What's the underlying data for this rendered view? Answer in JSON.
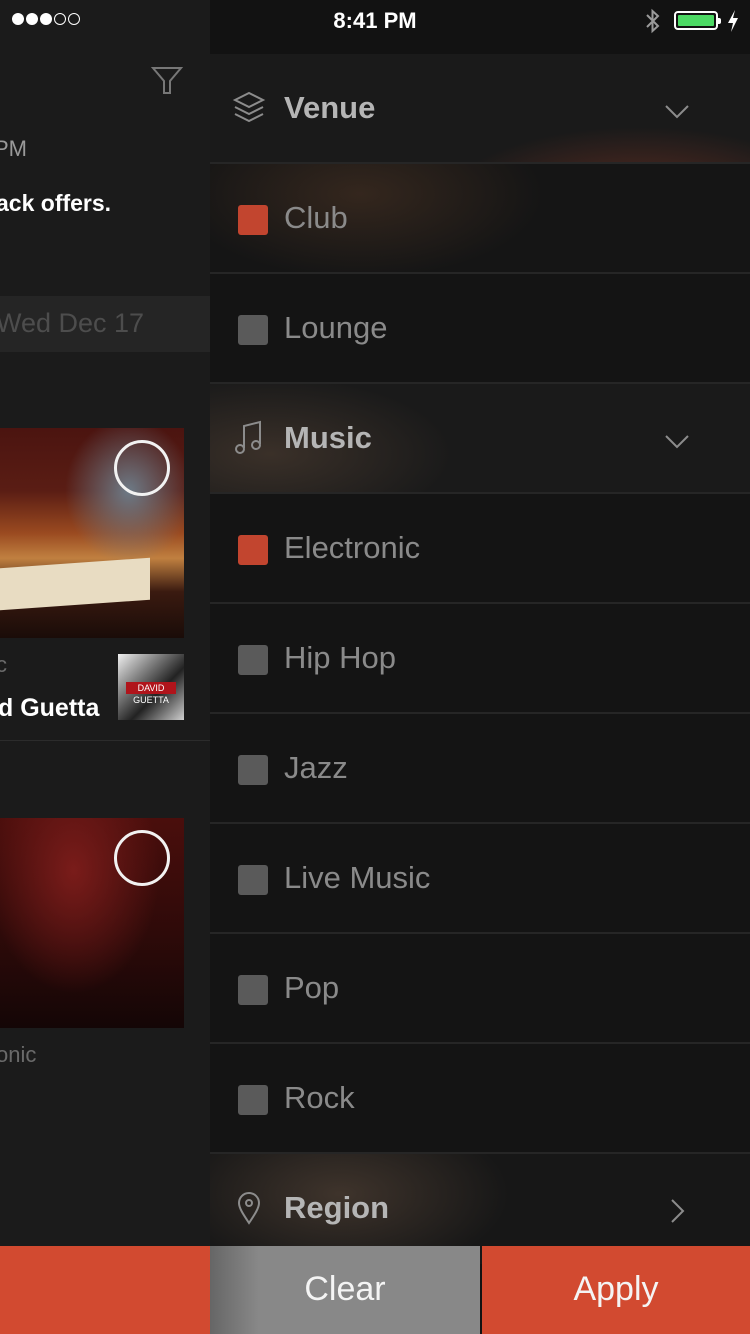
{
  "status_bar": {
    "time": "8:41 PM",
    "signal_bars": 3,
    "signal_total": 5,
    "battery_level": 0.9
  },
  "feed": {
    "time_fragment": "PM",
    "offers_fragment": "ack offers.",
    "date_fragment": "Wed Dec 17",
    "event1": {
      "genre_fragment": "c",
      "artist_fragment": "d Guetta",
      "thumb_text": "DAVID GUETTA"
    },
    "event2": {
      "genre_fragment": "onic"
    }
  },
  "filters": {
    "venue": {
      "title": "Venue",
      "icon": "layers-icon",
      "expanded": true,
      "options": [
        {
          "label": "Club",
          "checked": true
        },
        {
          "label": "Lounge",
          "checked": false
        }
      ]
    },
    "music": {
      "title": "Music",
      "icon": "music-note-icon",
      "expanded": true,
      "options": [
        {
          "label": "Electronic",
          "checked": true
        },
        {
          "label": "Hip Hop",
          "checked": false
        },
        {
          "label": "Jazz",
          "checked": false
        },
        {
          "label": "Live Music",
          "checked": false
        },
        {
          "label": "Pop",
          "checked": false
        },
        {
          "label": "Rock",
          "checked": false
        }
      ]
    },
    "region": {
      "title": "Region",
      "icon": "location-pin-icon",
      "expanded": false
    }
  },
  "actions": {
    "clear": "Clear",
    "apply": "Apply"
  },
  "colors": {
    "accent": "#d24a30",
    "checked": "#c2452f",
    "unchecked": "#5a5a5a",
    "battery": "#4cd964"
  }
}
